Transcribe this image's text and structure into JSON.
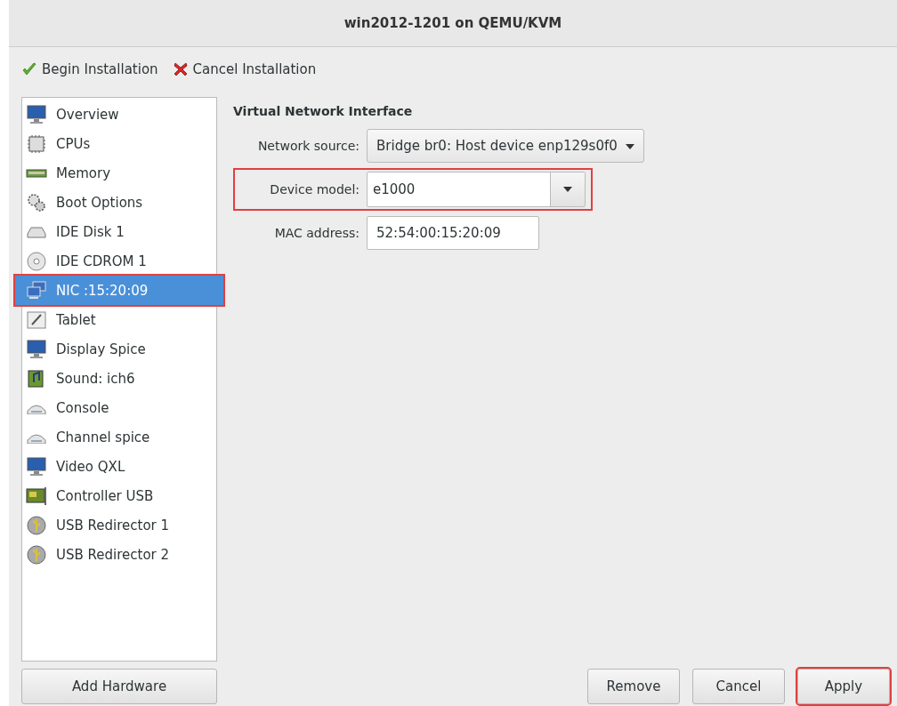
{
  "window": {
    "title": "win2012-1201 on QEMU/KVM"
  },
  "toolbar": [
    {
      "kind": "begin",
      "label": "Begin Installation"
    },
    {
      "kind": "cancel",
      "label": "Cancel Installation"
    }
  ],
  "hardware": [
    {
      "kind": "monitor",
      "label": "Overview",
      "selected": false,
      "highlighted": false
    },
    {
      "kind": "chip",
      "label": "CPUs",
      "selected": false,
      "highlighted": false
    },
    {
      "kind": "memory",
      "label": "Memory",
      "selected": false,
      "highlighted": false
    },
    {
      "kind": "gears",
      "label": "Boot Options",
      "selected": false,
      "highlighted": false
    },
    {
      "kind": "disk",
      "label": "IDE Disk 1",
      "selected": false,
      "highlighted": false
    },
    {
      "kind": "cdrom",
      "label": "IDE CDROM 1",
      "selected": false,
      "highlighted": false
    },
    {
      "kind": "network",
      "label": "NIC :15:20:09",
      "selected": true,
      "highlighted": true
    },
    {
      "kind": "tablet",
      "label": "Tablet",
      "selected": false,
      "highlighted": false
    },
    {
      "kind": "monitor",
      "label": "Display Spice",
      "selected": false,
      "highlighted": false
    },
    {
      "kind": "sound",
      "label": "Sound: ich6",
      "selected": false,
      "highlighted": false
    },
    {
      "kind": "serial",
      "label": "Console",
      "selected": false,
      "highlighted": false
    },
    {
      "kind": "serial",
      "label": "Channel spice",
      "selected": false,
      "highlighted": false
    },
    {
      "kind": "monitor",
      "label": "Video QXL",
      "selected": false,
      "highlighted": false
    },
    {
      "kind": "card",
      "label": "Controller USB",
      "selected": false,
      "highlighted": false
    },
    {
      "kind": "usb",
      "label": "USB Redirector 1",
      "selected": false,
      "highlighted": false
    },
    {
      "kind": "usb",
      "label": "USB Redirector 2",
      "selected": false,
      "highlighted": false
    }
  ],
  "add_hardware": {
    "label": "Add Hardware"
  },
  "details": {
    "heading": "Virtual Network Interface",
    "fields": [
      {
        "kind": "dropdown",
        "label": "Network source:",
        "value": "Bridge br0: Host device enp129s0f0",
        "highlighted": false
      },
      {
        "kind": "combo",
        "label": "Device model:",
        "value": "e1000",
        "highlighted": true
      },
      {
        "kind": "text",
        "label": "MAC address:",
        "value": "52:54:00:15:20:09",
        "highlighted": false
      }
    ]
  },
  "buttons": [
    {
      "label": "Remove",
      "highlighted": false
    },
    {
      "label": "Cancel",
      "highlighted": false
    },
    {
      "label": "Apply",
      "highlighted": true
    }
  ]
}
